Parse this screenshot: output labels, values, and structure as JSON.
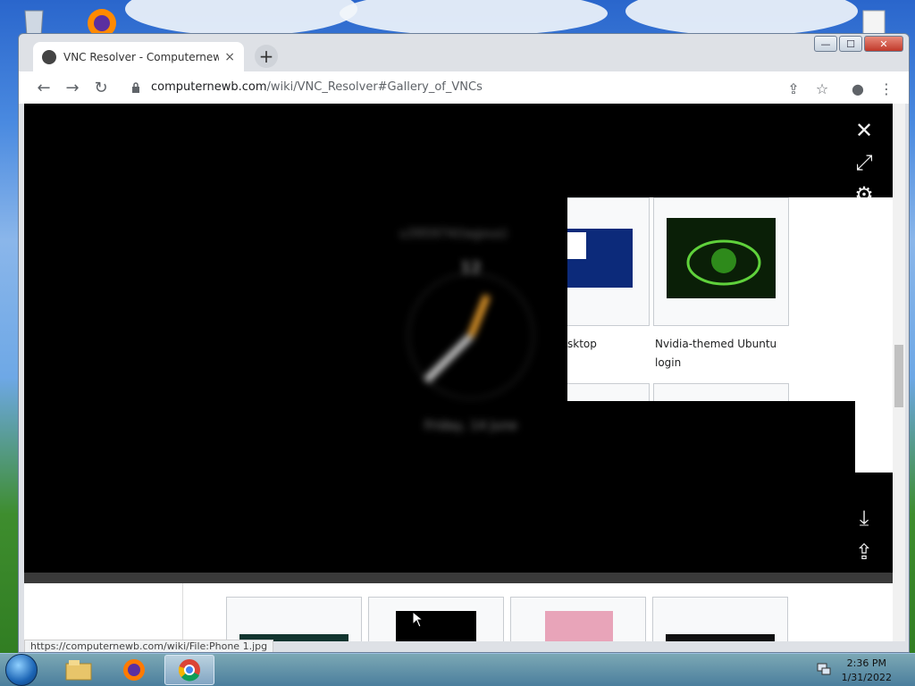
{
  "desktop": {
    "icons": [
      "recycle-bin-icon",
      "firefox-icon",
      "document-icon"
    ]
  },
  "browser": {
    "tab": {
      "title": "VNC Resolver - Computernewb W",
      "close": "×"
    },
    "new_tab": "+",
    "url": {
      "host": "computernewb.com",
      "path": "/wiki/VNC_Resolver#Gallery_of_VNCs"
    },
    "window_controls": {
      "minimize": "—",
      "maximize": "☐",
      "close": "✕"
    }
  },
  "lightbox": {
    "close": "✕",
    "expand": "⤢",
    "settings": "⚙",
    "download": "⤓",
    "share": "⇪",
    "phone": {
      "time": "12",
      "date": "Friday, 14 June"
    }
  },
  "gallery": {
    "captions": [
      {
        "text": "sktop"
      },
      {
        "line1": "Nvidia-themed Ubuntu",
        "line2": "login"
      }
    ]
  },
  "status_bar": {
    "text": "https://computernewb.com/wiki/File:Phone 1.jpg"
  },
  "taskbar": {
    "apps": [
      "file-explorer-icon",
      "firefox-icon",
      "chrome-icon"
    ],
    "time": "2:36 PM",
    "date": "1/31/2022"
  }
}
